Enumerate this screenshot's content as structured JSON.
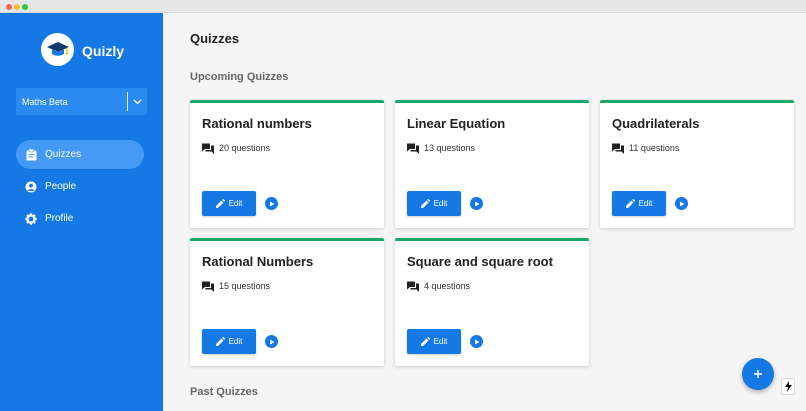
{
  "app": {
    "name": "Quizly"
  },
  "sidebar": {
    "class_select": {
      "value": "Maths Beta"
    },
    "nav": [
      {
        "label": "Quizzes",
        "icon": "clipboard-icon",
        "active": true
      },
      {
        "label": "People",
        "icon": "person-icon",
        "active": false
      },
      {
        "label": "Profile",
        "icon": "gear-icon",
        "active": false
      }
    ]
  },
  "main": {
    "title": "Quizzes",
    "upcoming_title": "Upcoming Quizzes",
    "past_title": "Past Quizzes",
    "edit_label": "Edit",
    "quizzes": [
      {
        "title": "Rational numbers",
        "questions": "20 questions"
      },
      {
        "title": "Linear Equation",
        "questions": "13 questions"
      },
      {
        "title": "Quadrilaterals",
        "questions": "11 questions"
      },
      {
        "title": "Rational Numbers",
        "questions": "15 questions"
      },
      {
        "title": "Square and square root",
        "questions": "4 questions"
      }
    ]
  },
  "colors": {
    "primary": "#1479e4",
    "accent": "#1aa86b",
    "background": "#f5f5f5"
  }
}
